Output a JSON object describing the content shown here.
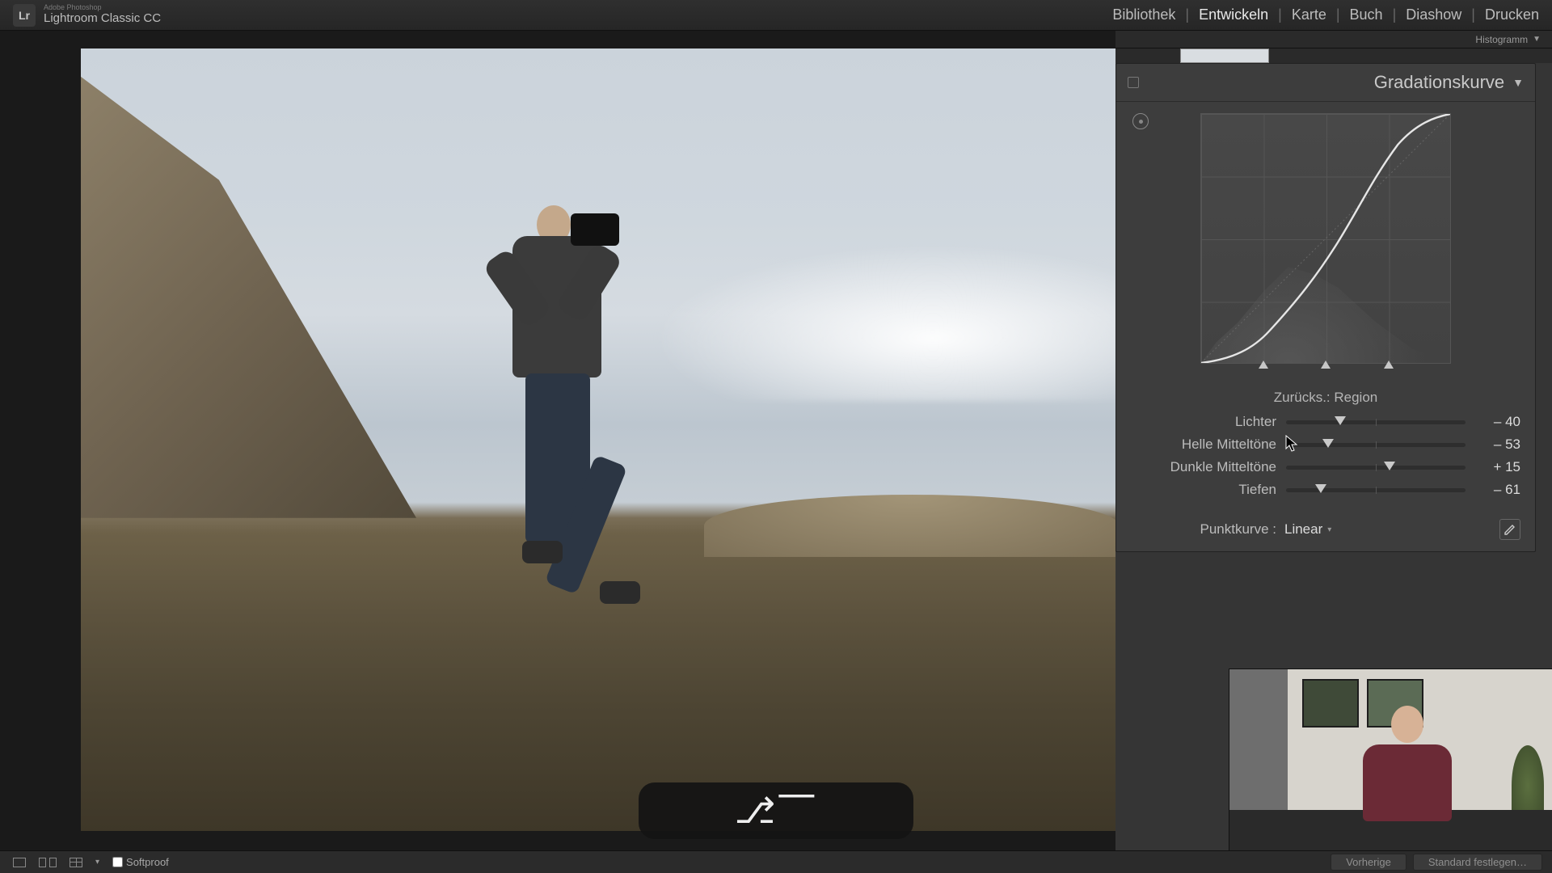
{
  "app": {
    "vendor": "Adobe Photoshop",
    "name": "Lightroom Classic CC",
    "logo": "Lr"
  },
  "modules": {
    "library": "Bibliothek",
    "develop": "Entwickeln",
    "map": "Karte",
    "book": "Buch",
    "slideshow": "Diashow",
    "print": "Drucken",
    "active": "develop"
  },
  "histogram_label": "Histogramm",
  "panel": {
    "title": "Gradationskurve",
    "target_tool": "targeted-adjustment",
    "region_label": "Zurücks.: Region",
    "splits": [
      25,
      50,
      75
    ],
    "sliders": [
      {
        "key": "highlights",
        "label": "Lichter",
        "value": -40,
        "display": "– 40"
      },
      {
        "key": "lights",
        "label": "Helle Mitteltöne",
        "value": -53,
        "display": "– 53"
      },
      {
        "key": "darks",
        "label": "Dunkle Mitteltöne",
        "value": 15,
        "display": "+ 15"
      },
      {
        "key": "shadows",
        "label": "Tiefen",
        "value": -61,
        "display": "– 61"
      }
    ],
    "point_curve": {
      "label": "Punktkurve :",
      "value": "Linear"
    }
  },
  "toolbar": {
    "softproof": "Softproof",
    "prev": "Vorherige",
    "reset": "Standard festlegen…"
  },
  "key_overlay": "⌥",
  "cursor_title_hint": "Region"
}
